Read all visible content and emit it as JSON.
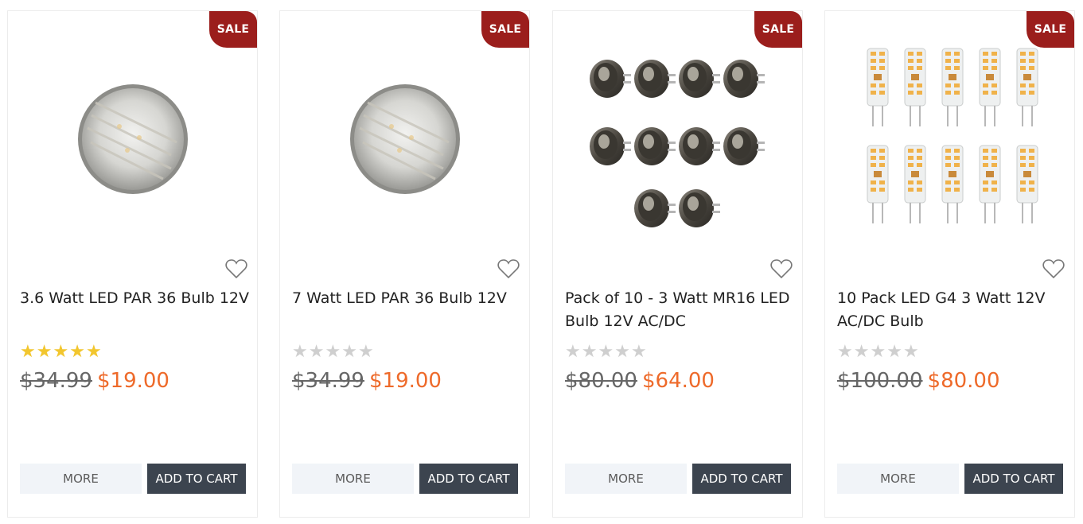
{
  "products": [
    {
      "badge": "SALE",
      "image": "led-par36-bulb",
      "title": "3.6 Watt LED PAR 36 Bulb 12V",
      "rating": 5,
      "max_rating": 5,
      "old_price": "$34.99",
      "price": "$19.00",
      "more_label": "MORE",
      "cart_label": "ADD TO CART"
    },
    {
      "badge": "SALE",
      "image": "led-par36-bulb",
      "title": "7 Watt LED PAR 36 Bulb 12V",
      "rating": 0,
      "max_rating": 5,
      "old_price": "$34.99",
      "price": "$19.00",
      "more_label": "MORE",
      "cart_label": "ADD TO CART"
    },
    {
      "badge": "SALE",
      "image": "mr16-bulbs-pack-of-10",
      "title": "Pack of 10 - 3 Watt MR16 LED Bulb 12V AC/DC",
      "rating": 0,
      "max_rating": 5,
      "old_price": "$80.00",
      "price": "$64.00",
      "more_label": "MORE",
      "cart_label": "ADD TO CART"
    },
    {
      "badge": "SALE",
      "image": "g4-led-bulbs-pack-of-10",
      "title": "10 Pack LED G4 3 Watt 12V AC/DC Bulb",
      "rating": 0,
      "max_rating": 5,
      "old_price": "$100.00",
      "price": "$80.00",
      "more_label": "MORE",
      "cart_label": "ADD TO CART"
    }
  ],
  "colors": {
    "sale_badge": "#9b1e1c",
    "price": "#ee6a2a",
    "star_on": "#f2c62e",
    "star_off": "#cfcfcf",
    "cart_button": "#3c444f",
    "more_button": "#f1f4f8"
  },
  "icons": {
    "wishlist": "heart-outline-icon",
    "rating": "star-icon"
  }
}
